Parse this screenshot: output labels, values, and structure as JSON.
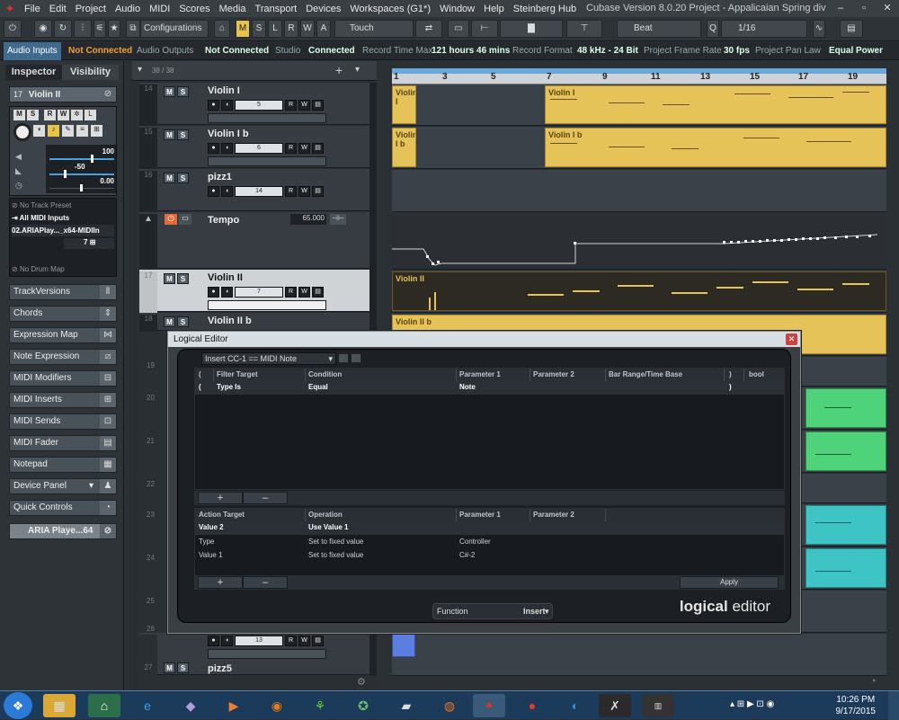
{
  "menubar": {
    "items": [
      "File",
      "Edit",
      "Project",
      "Audio",
      "MIDI",
      "Scores",
      "Media",
      "Transport",
      "Devices",
      "Workspaces (G1*)",
      "Window",
      "Help",
      "Steinberg Hub"
    ],
    "title": "Cubase Version 8.0.20 Project - Appalicaian Spring div"
  },
  "toolbar": {
    "configurations": "Configurations",
    "mode_buttons": [
      "M",
      "S",
      "L",
      "R",
      "W",
      "A"
    ],
    "automation_mode": "Touch",
    "snap_type": "Beat",
    "quantize": "1/16"
  },
  "statusbar": {
    "audio_inputs_label": "Audio Inputs",
    "audio_inputs_value": "Not Connected",
    "audio_outputs_label": "Audio Outputs",
    "audio_outputs_value": "Not Connected",
    "studio_label": "Studio",
    "studio_value": "Connected",
    "record_time_label": "Record Time Max",
    "record_time_value": "121 hours 46 mins",
    "record_format_label": "Record Format",
    "record_format_value": "48 kHz - 24 Bit",
    "frame_rate_label": "Project Frame Rate",
    "frame_rate_value": "30 fps",
    "pan_law_label": "Project Pan Law",
    "pan_law_value": "Equal Power"
  },
  "inspector": {
    "tabs": [
      "Inspector",
      "Visibility"
    ],
    "track_number": "17",
    "track_name": "Violin II",
    "volume_value": "100",
    "pan_value": "-50",
    "delay_value": "0.00",
    "track_preset": "No Track Preset",
    "midi_input": "All MIDI Inputs",
    "midi_output": "02.ARIAPlay..._x64-MIDIIn",
    "channel": "7",
    "drum_map": "No Drum Map",
    "sections": [
      "TrackVersions",
      "Chords",
      "Expression Map",
      "Note Expression",
      "MIDI Modifiers",
      "MIDI Inserts",
      "MIDI Sends",
      "MIDI Fader",
      "Notepad",
      "Device Panel",
      "Quick Controls"
    ],
    "instrument": "ARIA Playe...64"
  },
  "tracklist": {
    "count": "38 / 38",
    "tracks": [
      {
        "num": "14",
        "name": "Violin I",
        "ch": "5"
      },
      {
        "num": "15",
        "name": "Violin I b",
        "ch": "6"
      },
      {
        "num": "16",
        "name": "pizz1",
        "ch": "14"
      },
      {
        "num": "",
        "name": "Tempo",
        "tempo": "65.000"
      },
      {
        "num": "17",
        "name": "Violin II",
        "ch": "7"
      },
      {
        "num": "18",
        "name": "Violin II b",
        "ch": ""
      }
    ],
    "hidden_nums": [
      "19",
      "20",
      "21",
      "22",
      "23",
      "24",
      "25",
      "26",
      "27"
    ],
    "bottom_track": "pizz5",
    "bottom_ch": "13"
  },
  "ruler": {
    "bars": [
      "1",
      "3",
      "5",
      "7",
      "9",
      "11",
      "13",
      "15",
      "17",
      "19"
    ]
  },
  "parts": {
    "violin1": "Violin I",
    "violin1b": "Violin I b",
    "violin2": "Violin II",
    "violin2b": "Violin II b"
  },
  "logical_editor": {
    "title": "Logical Editor",
    "preset": "Insert CC-1 == MIDI Note",
    "filter_headers": [
      "(",
      "Filter Target",
      "Condition",
      "Parameter 1",
      "Parameter 2",
      "Bar Range/Time Base",
      ")",
      "bool"
    ],
    "filter_rows": [
      {
        "open": "(",
        "target": "Type Is",
        "condition": "Equal",
        "param1": "Note",
        "param2": "",
        "range": "",
        "close": ")",
        "bool": ""
      }
    ],
    "action_headers": [
      "Action Target",
      "Operation",
      "Parameter 1",
      "Parameter 2"
    ],
    "action_rows": [
      {
        "target": "Value 2",
        "operation": "Use Value 1",
        "param1": "",
        "param2": ""
      },
      {
        "target": "Type",
        "operation": "Set to fixed value",
        "param1": "Controller",
        "param2": ""
      },
      {
        "target": "Value 1",
        "operation": "Set to fixed value",
        "param1": "C#-2",
        "param2": ""
      }
    ],
    "plus": "+",
    "minus": "–",
    "apply": "Apply",
    "function_label": "Function",
    "function_value": "Insert",
    "logo_bold": "logical",
    "logo_light": "editor"
  },
  "taskbar": {
    "time": "10:26 PM",
    "date": "9/17/2015"
  }
}
